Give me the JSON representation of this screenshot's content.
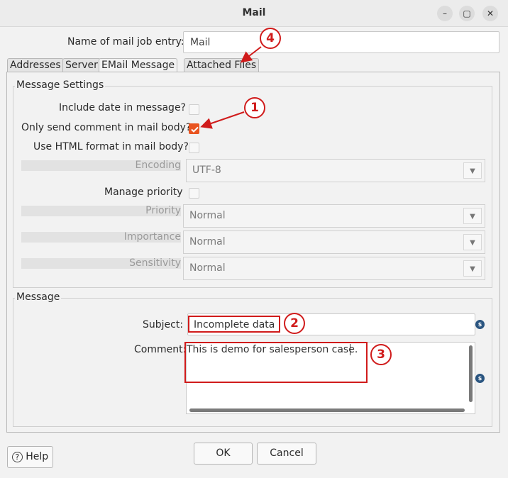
{
  "window": {
    "title": "Mail",
    "minimize_glyph": "–",
    "maximize_glyph": "▢",
    "close_glyph": "✕"
  },
  "entry": {
    "label": "Name of mail job entry:",
    "value": "Mail"
  },
  "tabs": [
    {
      "label": "Addresses"
    },
    {
      "label": "Server"
    },
    {
      "label": "EMail Message"
    },
    {
      "label": "Attached Files"
    }
  ],
  "message_settings": {
    "title": "Message Settings",
    "include_date_label": "Include date in message?",
    "only_comment_label": "Only send comment in mail body?",
    "html_format_label": "Use HTML format in mail body?",
    "encoding_label": "Encoding",
    "encoding_value": "UTF-8",
    "manage_priority_label": "Manage priority",
    "priority_label": "Priority",
    "priority_value": "Normal",
    "importance_label": "Importance",
    "importance_value": "Normal",
    "sensitivity_label": "Sensitivity",
    "sensitivity_value": "Normal",
    "only_comment_checked": true
  },
  "message": {
    "title": "Message",
    "subject_label": "Subject:",
    "subject_value": "Incomplete data",
    "comment_label": "Comment:",
    "comment_value": "This is demo for salesperson case."
  },
  "buttons": {
    "help": "Help",
    "ok": "OK",
    "cancel": "Cancel"
  },
  "annotations": [
    "1",
    "2",
    "3",
    "4"
  ],
  "colors": {
    "accent": "#e95420",
    "annotation": "#d01b1b",
    "variable_icon": "#2a5580"
  },
  "icons": {
    "dropdown": "chevron-down-icon",
    "variable": "variable-dollar-icon",
    "help": "question-circle-icon",
    "check": "checkmark-icon"
  }
}
